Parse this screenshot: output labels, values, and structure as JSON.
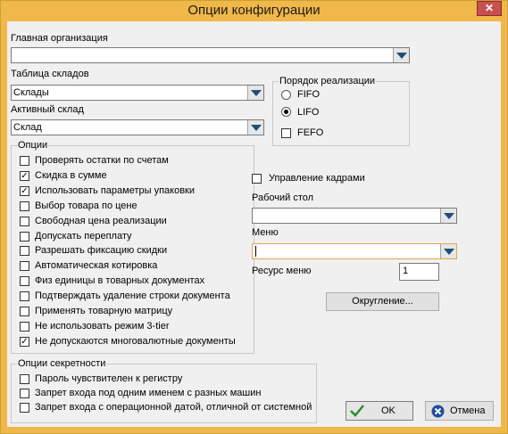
{
  "window": {
    "title": "Опции конфигурации",
    "close_glyph": "✕"
  },
  "main_org": {
    "label": "Главная организация",
    "value": ""
  },
  "warehouse_table": {
    "label": "Таблица складов",
    "value": "Склады"
  },
  "active_warehouse": {
    "label": "Активный склад",
    "value": "Склад"
  },
  "sales_order": {
    "legend": "Порядок реализации",
    "radios": [
      {
        "label": "FIFO",
        "checked": false
      },
      {
        "label": "LIFO",
        "checked": true
      }
    ],
    "fefo": {
      "label": "FEFO",
      "checked": false
    }
  },
  "options": {
    "legend": "Опции",
    "items": [
      {
        "label": "Проверять остатки по счетам",
        "checked": false
      },
      {
        "label": "Скидка в сумме",
        "checked": true
      },
      {
        "label": "Использовать параметры упаковки",
        "checked": true
      },
      {
        "label": "Выбор товара по цене",
        "checked": false
      },
      {
        "label": "Свободная цена реализации",
        "checked": false
      },
      {
        "label": "Допускать переплату",
        "checked": false
      },
      {
        "label": "Разрешать фиксацию скидки",
        "checked": false
      },
      {
        "label": "Автоматическая котировка",
        "checked": false
      },
      {
        "label": "Физ единицы в товарных документах",
        "checked": false
      },
      {
        "label": "Подтверждать удаление строки документа",
        "checked": false
      },
      {
        "label": "Применять товарную матрицу",
        "checked": false
      },
      {
        "label": "Не использовать режим 3-tier",
        "checked": false
      },
      {
        "label": "Не допускаются многовалютные документы",
        "checked": true
      }
    ]
  },
  "hr": {
    "label": "Управление кадрами",
    "checked": false
  },
  "desktop": {
    "label": "Рабочий стол",
    "value": ""
  },
  "menu": {
    "label": "Меню",
    "value": ""
  },
  "menu_resource": {
    "label": "Ресурс меню",
    "value": "1"
  },
  "rounding_button": {
    "label": "Округление..."
  },
  "security": {
    "legend": "Опции секретности",
    "items": [
      {
        "label": "Пароль чувствителен к регистру",
        "checked": false
      },
      {
        "label": "Запрет входа под одним именем с разных машин",
        "checked": false
      },
      {
        "label": "Запрет входа с операционной датой, отличной от системной",
        "checked": false
      }
    ]
  },
  "ok_button": {
    "label": "OK"
  },
  "cancel_button": {
    "label": "Отмена"
  },
  "check_glyph": "✓",
  "colors": {
    "title_bar": "#f0b74a",
    "close_button": "#c75050",
    "ok_icon": "#2f8a2f",
    "cancel_icon": "#1f4e9e",
    "combo_arrow": "#1f4e79"
  }
}
